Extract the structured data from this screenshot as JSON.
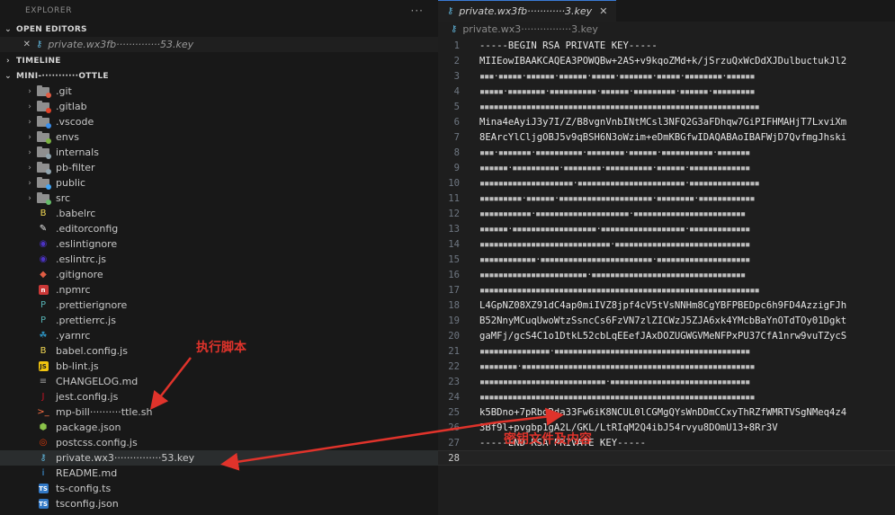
{
  "sidebar": {
    "title": "EXPLORER",
    "more": "···",
    "open_editors": {
      "label": "OPEN EDITORS",
      "items": [
        {
          "name": "private.wx3fb··············53.key",
          "close": "✕"
        }
      ]
    },
    "timeline": {
      "label": "TIMELINE"
    },
    "project": {
      "label": "MINI-···········OTTLE",
      "entries": [
        {
          "name": ".git",
          "kind": "folder",
          "color": "#e05d44",
          "icon": "folder-git-icon"
        },
        {
          "name": ".gitlab",
          "kind": "folder",
          "color": "#e24329",
          "icon": "folder-gitlab-icon"
        },
        {
          "name": ".vscode",
          "kind": "folder",
          "color": "#3b8eea",
          "icon": "folder-vscode-icon"
        },
        {
          "name": "envs",
          "kind": "folder",
          "color": "#7cb342",
          "icon": "folder-envs-icon"
        },
        {
          "name": "internals",
          "kind": "folder",
          "color": "#90a4ae",
          "icon": "folder-icon"
        },
        {
          "name": "pb-filter",
          "kind": "folder",
          "color": "#90a4ae",
          "icon": "folder-icon"
        },
        {
          "name": "public",
          "kind": "folder",
          "color": "#42a5f5",
          "icon": "folder-public-icon"
        },
        {
          "name": "src",
          "kind": "folder",
          "color": "#66bb6a",
          "icon": "folder-src-icon"
        },
        {
          "name": ".babelrc",
          "kind": "file",
          "glyph": "B",
          "color": "#f5da55",
          "icon": "babel-icon"
        },
        {
          "name": ".editorconfig",
          "kind": "file",
          "glyph": "✎",
          "color": "#e8e8e8",
          "icon": "editorconfig-icon"
        },
        {
          "name": ".eslintignore",
          "kind": "file",
          "glyph": "◉",
          "color": "#4b32c3",
          "icon": "eslint-icon"
        },
        {
          "name": ".eslintrc.js",
          "kind": "file",
          "glyph": "◉",
          "color": "#4b32c3",
          "icon": "eslint-icon"
        },
        {
          "name": ".gitignore",
          "kind": "file",
          "glyph": "◆",
          "color": "#e05d44",
          "icon": "git-icon"
        },
        {
          "name": ".npmrc",
          "kind": "file",
          "glyph": "n",
          "color": "#cb3837",
          "icon": "npm-icon"
        },
        {
          "name": ".prettierignore",
          "kind": "file",
          "glyph": "P",
          "color": "#56b3b4",
          "icon": "prettier-icon"
        },
        {
          "name": ".prettierrc.js",
          "kind": "file",
          "glyph": "P",
          "color": "#56b3b4",
          "icon": "prettier-icon"
        },
        {
          "name": ".yarnrc",
          "kind": "file",
          "glyph": "☘",
          "color": "#2c8ebb",
          "icon": "yarn-icon"
        },
        {
          "name": "babel.config.js",
          "kind": "file",
          "glyph": "B",
          "color": "#f5da55",
          "icon": "babel-icon"
        },
        {
          "name": "bb-lint.js",
          "kind": "file",
          "glyph": "JS",
          "color": "#f1c40f",
          "icon": "javascript-icon"
        },
        {
          "name": "CHANGELOG.md",
          "kind": "file",
          "glyph": "≡",
          "color": "#9e9e9e",
          "icon": "markdown-icon"
        },
        {
          "name": "jest.config.js",
          "kind": "file",
          "glyph": "J",
          "color": "#c21325",
          "icon": "jest-icon"
        },
        {
          "name": "mp-bill··········ttle.sh",
          "kind": "file",
          "glyph": ">_",
          "color": "#ff7043",
          "icon": "shell-icon"
        },
        {
          "name": "package.json",
          "kind": "file",
          "glyph": "⬢",
          "color": "#8bc34a",
          "icon": "nodejs-icon"
        },
        {
          "name": "postcss.config.js",
          "kind": "file",
          "glyph": "◎",
          "color": "#dd3a0a",
          "icon": "postcss-icon"
        },
        {
          "name": "private.wx3···············53.key",
          "kind": "file",
          "glyph": "⚷",
          "color": "#5fb3d9",
          "icon": "key-icon",
          "selected": true
        },
        {
          "name": "README.md",
          "kind": "file",
          "glyph": "i",
          "color": "#42a5f5",
          "icon": "info-icon"
        },
        {
          "name": "ts-config.ts",
          "kind": "file",
          "glyph": "TS",
          "color": "#3178c6",
          "icon": "typescript-icon"
        },
        {
          "name": "tsconfig.json",
          "kind": "file",
          "glyph": "TS",
          "color": "#3178c6",
          "icon": "tsconfig-icon"
        }
      ]
    }
  },
  "editor": {
    "tab": {
      "title": "private.wx3fb············3.key",
      "close": "✕"
    },
    "breadcrumb": "private.wx3················3.key",
    "lines": [
      "-----BEGIN RSA PRIVATE KEY-----",
      "MIIEowIBAAKCAQEA3POWQBw+2AS+v9kqoZMd+k/jSrzuQxWcDdXJDulbuctukJl2",
      "▪▪▪·▪▪▪▪▪·▪▪▪▪▪▪·▪▪▪▪▪▪·▪▪▪▪▪·▪▪▪▪▪▪▪·▪▪▪▪▪·▪▪▪▪▪▪▪▪·▪▪▪▪▪▪",
      "▪▪▪▪▪·▪▪▪▪▪▪▪▪·▪▪▪▪▪▪▪▪▪▪·▪▪▪▪▪▪·▪▪▪▪▪▪▪▪▪·▪▪▪▪▪▪·▪▪▪▪▪▪▪▪▪",
      "▪▪▪▪▪▪▪▪▪▪▪▪▪▪▪▪▪▪▪▪▪▪▪▪▪▪▪▪▪▪▪▪▪▪▪▪▪▪▪▪▪▪▪▪▪▪▪▪▪▪▪▪▪▪▪▪▪▪▪▪",
      "Mina4eAyiJ3y7I/Z/B8vgnVnbINtMCsl3NFQ2G3aFDhqw7GiPIFHMAHjT7LxviXm",
      "8EArcYlCljgOBJ5v9qBSH6N3oWzim+eDmKBGfwIDAQABAoIBAFWjD7QvfmgJhski",
      "▪▪▪·▪▪▪▪▪▪▪·▪▪▪▪▪▪▪▪▪▪·▪▪▪▪▪▪▪▪·▪▪▪▪▪▪·▪▪▪▪▪▪▪▪▪▪▪·▪▪▪▪▪▪▪",
      "▪▪▪▪▪▪·▪▪▪▪▪▪▪▪▪▪·▪▪▪▪▪▪▪▪·▪▪▪▪▪▪▪▪▪▪·▪▪▪▪▪▪·▪▪▪▪▪▪▪▪▪▪▪▪▪",
      "▪▪▪▪▪▪▪▪▪▪▪▪▪▪▪▪▪▪▪▪·▪▪▪▪▪▪▪▪▪▪▪▪▪▪▪▪▪▪▪▪▪▪▪·▪▪▪▪▪▪▪▪▪▪▪▪▪▪▪",
      "▪▪▪▪▪▪▪▪▪·▪▪▪▪▪▪·▪▪▪▪▪▪▪▪▪▪▪▪▪▪▪▪▪▪▪▪·▪▪▪▪▪▪▪▪·▪▪▪▪▪▪▪▪▪▪▪▪",
      "▪▪▪▪▪▪▪▪▪▪▪·▪▪▪▪▪▪▪▪▪▪▪▪▪▪▪▪▪▪▪▪·▪▪▪▪▪▪▪▪▪▪▪▪▪▪▪▪▪▪▪▪▪▪▪▪",
      "▪▪▪▪▪▪·▪▪▪▪▪▪▪▪▪▪▪▪▪▪▪▪▪▪·▪▪▪▪▪▪▪▪▪▪▪▪▪▪▪▪▪▪·▪▪▪▪▪▪▪▪▪▪▪▪▪",
      "▪▪▪▪▪▪▪▪▪▪▪▪▪▪▪▪▪▪▪▪▪▪▪▪▪▪▪▪·▪▪▪▪▪▪▪▪▪▪▪▪▪▪▪▪▪▪▪▪▪▪▪▪▪▪▪▪▪",
      "▪▪▪▪▪▪▪▪▪▪▪▪·▪▪▪▪▪▪▪▪▪▪▪▪▪▪▪▪▪▪▪▪▪▪▪▪·▪▪▪▪▪▪▪▪▪▪▪▪▪▪▪▪▪▪▪▪",
      "▪▪▪▪▪▪▪▪▪▪▪▪▪▪▪▪▪▪▪▪▪▪▪·▪▪▪▪▪▪▪▪▪▪▪▪▪▪▪▪▪▪▪▪▪▪▪▪▪▪▪▪▪▪▪▪▪",
      "▪▪▪▪▪▪▪▪▪▪▪▪▪▪▪▪▪▪▪▪▪▪▪▪▪▪▪▪▪▪▪▪▪▪▪▪▪▪▪▪▪▪▪▪▪▪▪▪▪▪▪▪▪▪▪▪▪▪▪▪",
      "L4GpNZ08XZ91dC4ap0miIVZ8jpf4cV5tVsNNHm8CgYBFPBEDpc6h9FD4AzzigFJh",
      "B52NnyMCuqUwoWtzSsncCs6FzVN7zlZICWzJ5ZJA6xk4YMcbBaYnOTdTOy01Dgkt",
      "gaMFj/gcS4C1o1DtkL52cbLqEEefJAxDOZUGWGVMeNFPxPU37CfA1nrw9vuTZycS",
      "▪▪▪▪▪▪▪▪▪▪▪▪▪▪▪·▪▪▪▪▪▪▪▪▪▪▪▪▪▪▪▪▪▪▪▪▪▪▪▪▪▪▪▪▪▪▪▪▪▪▪▪▪▪▪▪▪▪",
      "▪▪▪▪▪▪▪▪·▪▪▪▪▪▪▪▪▪▪▪▪▪▪▪▪▪▪▪▪▪▪▪▪▪▪▪▪▪▪▪▪▪▪▪▪▪▪▪▪▪▪▪▪▪▪▪▪▪▪",
      "▪▪▪▪▪▪▪▪▪▪▪▪▪▪▪▪▪▪▪▪▪▪▪▪▪▪▪·▪▪▪▪▪▪▪▪▪▪▪▪▪▪▪▪▪▪▪▪▪▪▪▪▪▪▪▪▪▪",
      "▪▪▪▪▪▪▪▪▪▪▪▪▪▪▪▪▪▪▪▪▪▪▪▪▪▪▪▪▪▪▪▪▪▪▪▪▪▪▪▪▪▪▪▪▪▪▪▪▪▪▪▪▪▪▪▪▪▪▪",
      "k5BDno+7pRbgRda33Fw6iK8NCUL0lCGMgQYsWnDDmCCxyThRZfWMRTVSgNMeq4z4",
      "3Bf9l+pvgbp1gA2L/GKL/LtRIqM2Q4ibJ54rvyu8DOmU13+8Rr3V",
      "-----END RSA PRIVATE KEY-----",
      ""
    ]
  },
  "annotations": {
    "script_note": "执行脚本",
    "key_note": "密钥文件及内容",
    "color": "#e0332b"
  }
}
